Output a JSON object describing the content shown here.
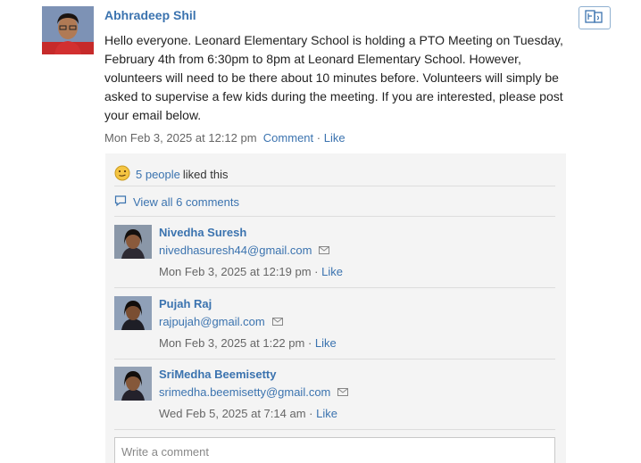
{
  "post": {
    "author": "Abhradeep Shil",
    "body": "Hello everyone. Leonard Elementary School is holding a PTO Meeting on Tuesday, February 4th from 6:30pm to 8pm at Leonard Elementary School. However, volunteers will need to be there about 10 minutes before. Volunteers will simply be asked to supervise a few kids during the meeting. If you are interested, please post your email below.",
    "timestamp": "Mon Feb 3, 2025 at 12:12 pm",
    "comment_label": "Comment",
    "like_label": "Like"
  },
  "likes": {
    "count_label": "5 people",
    "suffix": "liked this",
    "icon": "smiley-icon"
  },
  "view_all": {
    "label": "View all 6 comments",
    "icon": "comment-bubble-icon"
  },
  "comments": [
    {
      "name": "Nivedha Suresh",
      "email": "nivedhasuresh44@gmail.com",
      "timestamp": "Mon Feb 3, 2025 at 12:19 pm",
      "like_label": "Like"
    },
    {
      "name": "Pujah Raj",
      "email": "rajpujah@gmail.com",
      "timestamp": "Mon Feb 3, 2025 at 1:22 pm",
      "like_label": "Like"
    },
    {
      "name": "SriMedha Beemisetty",
      "email": "srimedha.beemisetty@gmail.com",
      "timestamp": "Wed Feb 5, 2025 at 7:14 am",
      "like_label": "Like"
    }
  ],
  "comment_input": {
    "placeholder": "Write a comment"
  },
  "colors": {
    "link": "#3b73af",
    "panel_bg": "#f4f4f4",
    "meta_text": "#666666"
  }
}
